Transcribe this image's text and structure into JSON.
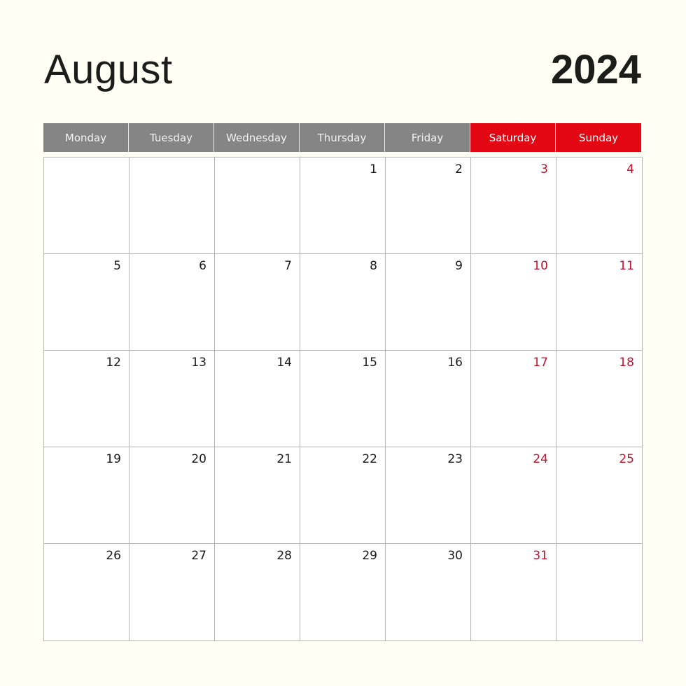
{
  "header": {
    "month": "August",
    "year": "2024"
  },
  "colors": {
    "weekday_header": "#858585",
    "weekend_header": "#e30613",
    "weekend_number": "#c8102e",
    "background": "#fffff6",
    "grid_line": "#b5b5b5"
  },
  "weekdays": [
    {
      "label": "Monday",
      "weekend": false
    },
    {
      "label": "Tuesday",
      "weekend": false
    },
    {
      "label": "Wednesday",
      "weekend": false
    },
    {
      "label": "Thursday",
      "weekend": false
    },
    {
      "label": "Friday",
      "weekend": false
    },
    {
      "label": "Saturday",
      "weekend": true
    },
    {
      "label": "Sunday",
      "weekend": true
    }
  ],
  "weeks": [
    [
      "",
      "",
      "",
      "1",
      "2",
      "3",
      "4"
    ],
    [
      "5",
      "6",
      "7",
      "8",
      "9",
      "10",
      "11"
    ],
    [
      "12",
      "13",
      "14",
      "15",
      "16",
      "17",
      "18"
    ],
    [
      "19",
      "20",
      "21",
      "22",
      "23",
      "24",
      "25"
    ],
    [
      "26",
      "27",
      "28",
      "29",
      "30",
      "31",
      ""
    ]
  ]
}
